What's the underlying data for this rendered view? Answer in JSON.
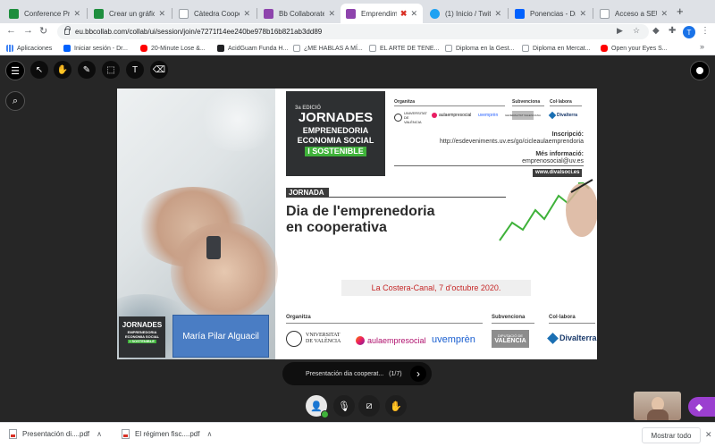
{
  "tabs": [
    {
      "label": "Conference Progr...",
      "color": "#1e8e3e",
      "active": false
    },
    {
      "label": "Crear un gráfico &...",
      "color": "#1e8e3e",
      "active": false
    },
    {
      "label": "Càtedra Cooperat...",
      "color": "#9aa0a6",
      "active": false
    },
    {
      "label": "Bb Collaborate Ses...",
      "color": "#8e44ad",
      "active": false
    },
    {
      "label": "Emprendimie",
      "color": "#8e44ad",
      "active": true
    },
    {
      "label": "(1) Inicio / Twitter",
      "color": "#1da1f2",
      "active": false
    },
    {
      "label": "Ponencias - Dropb...",
      "color": "#0061fe",
      "active": false
    },
    {
      "label": "Acceso a SEU",
      "color": "#9aa0a6",
      "active": false
    }
  ],
  "new_tab": "+",
  "address": "eu.bbcollab.com/collab/ui/session/join/e7271f14ee240be978b16b821ab3dd89",
  "profile_initial": "T",
  "bookmarks": [
    {
      "label": "Aplicaciones",
      "color": "#5f6368"
    },
    {
      "label": "Iniciar sesión - Dr...",
      "color": "#0061fe"
    },
    {
      "label": "20-Minute Lose &...",
      "color": "#ff0000"
    },
    {
      "label": "AcidGuam Funda H...",
      "color": "#202124"
    },
    {
      "label": "¿ME HABLAS A MÍ...",
      "color": "#9aa0a6"
    },
    {
      "label": "EL ARTE DE TENE...",
      "color": "#9aa0a6"
    },
    {
      "label": "Diploma en la Gest...",
      "color": "#9aa0a6"
    },
    {
      "label": "Diploma en Mercat...",
      "color": "#9aa0a6"
    },
    {
      "label": "Open your Eyes S...",
      "color": "#ff0000"
    }
  ],
  "slide": {
    "logo_edition": "3a EDICIÓ",
    "logo_line1": "JORNADES",
    "logo_line2": "EMPRENEDORIA",
    "logo_line3": "ECONOMIA SOCIAL",
    "logo_line4": "I SOSTENIBLE",
    "hdr_organitza": "Organitza",
    "hdr_subvenciona": "Subvenciona",
    "hdr_collabora": "Col·labora",
    "org_uv": "UNIVERSITAT DE VALÈNCIA",
    "org_aula": "aulaempresocial",
    "org_uvempren": "uvemprèn",
    "org_gv": "GENERALITAT VALENCIANA",
    "org_divalterra": "Divalterra",
    "inscripcio_label": "Inscripció:",
    "inscripcio_url": "http://esdeveniments.uv.es/go/cicleaulaemprendoria",
    "mes_info_label": "Més informació:",
    "mes_info_email": "emprenosocial@uv.es",
    "website": "www.divalsoci.es",
    "jornada_tag": "JORNADA",
    "title_line1": "Dia de l'emprenedoria",
    "title_line2": "en cooperativa",
    "date_location": "La Costera-Canal, 7 d'octubre 2020.",
    "speaker": "María Pilar Alguacil",
    "bottom_organitza": "Organitza",
    "bottom_subvenciona": "Subvenciona",
    "bottom_collabora": "Col·labora",
    "bottom_uv1": "VNIVERSITAT",
    "bottom_uv2": "DE VALÈNCIA",
    "bottom_aula": "aulaempresocial",
    "bottom_uvempren": "uvemprèn",
    "bottom_gv1": "DIPUTACIÓ DE",
    "bottom_gv2": "VALÈNCIA",
    "bottom_divalterra": "Divalterra"
  },
  "presentation": {
    "name": "Presentación dia cooperat...",
    "page": "(1/7)"
  },
  "downloads": [
    {
      "name": "Presentación di....pdf"
    },
    {
      "name": "El régimen fisc....pdf"
    }
  ],
  "show_all": "Mostrar todo"
}
